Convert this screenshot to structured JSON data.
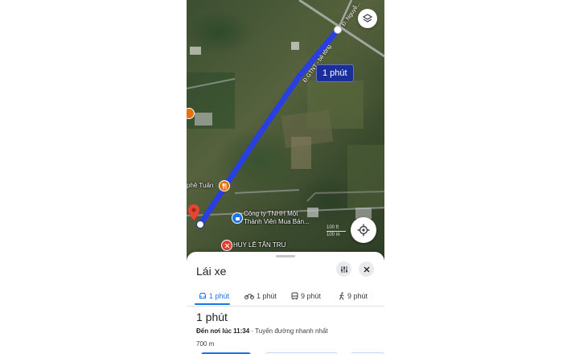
{
  "map": {
    "eta_chip": "1 phút",
    "road_label_top": "Đ. Nguyễ...",
    "road_label_main": "Đ.GTNT - bê tông",
    "poi_cafe": "phê Tuấn",
    "poi_company_line1": "Công ty TNHH Một",
    "poi_company_line2": "Thành Viên Mua Bán...",
    "poi_bottom": "HUY LÊ TẤN TRU",
    "scale_top": "100 ft",
    "scale_bottom": "100 m",
    "route_color": "#2a3fe0",
    "layers_icon": "layers-icon",
    "locate_icon": "my-location-icon"
  },
  "sheet": {
    "title": "Lái xe",
    "options_icon": "tune-icon",
    "close_icon": "close-icon",
    "tabs": [
      {
        "icon": "car-icon",
        "label": "1 phút"
      },
      {
        "icon": "motorbike-icon",
        "label": "1 phút"
      },
      {
        "icon": "transit-icon",
        "label": "9 phút"
      },
      {
        "icon": "walk-icon",
        "label": "9 phút"
      }
    ],
    "time": "1 phút",
    "arrival_prefix": "Đến nơi lúc",
    "arrival_time": "11:34",
    "arrival_suffix": "· Tuyến đường nhanh nhất",
    "distance": "700 m",
    "accent": "#1a73e8"
  }
}
